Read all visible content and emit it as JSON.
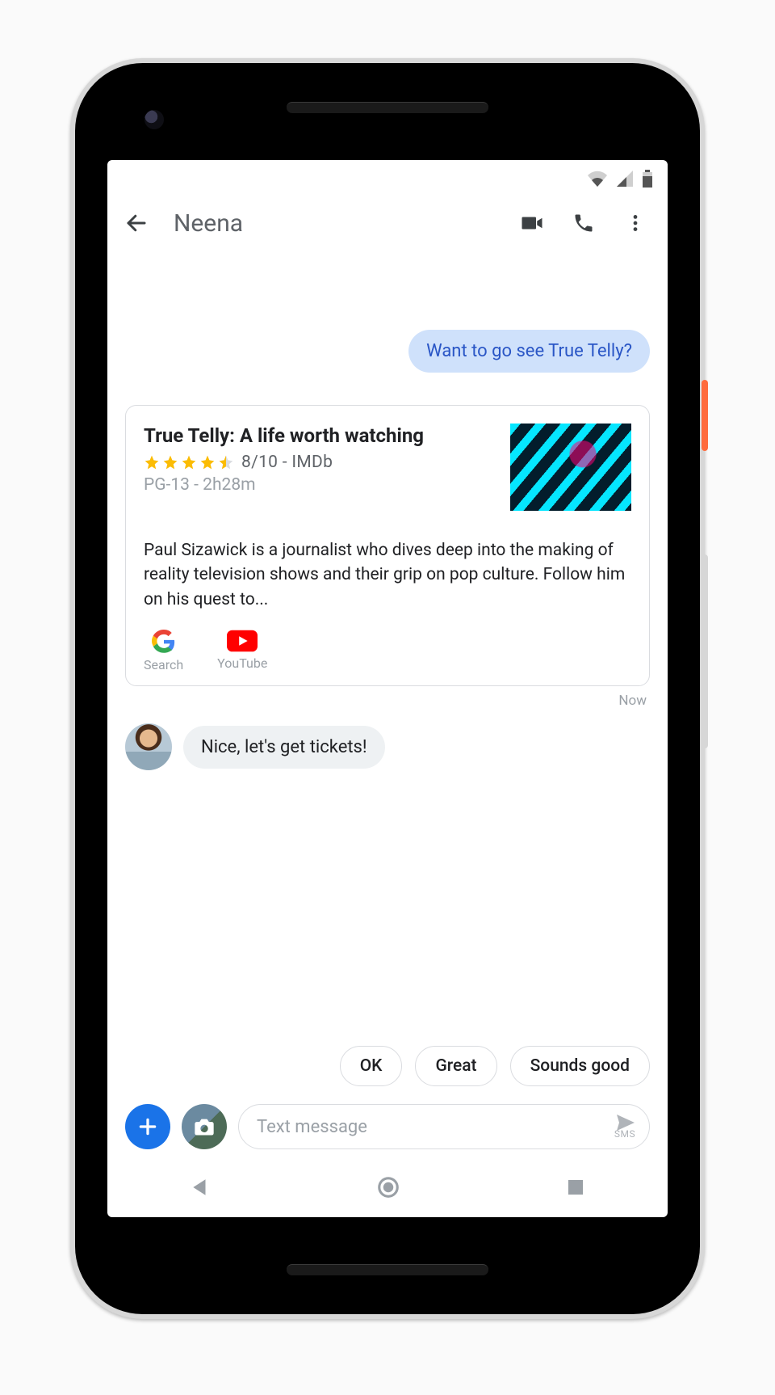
{
  "header": {
    "contact_name": "Neena"
  },
  "messages": {
    "outgoing_1": "Want to go see True Telly?",
    "incoming_1": "Nice, let's get tickets!"
  },
  "card": {
    "title": "True Telly: A life worth watching",
    "rating_text": "8/10 - IMDb",
    "meta": "PG-13 - 2h28m",
    "star_value": 4.5,
    "description": "Paul Sizawick is a journalist who dives deep into the making of reality television shows and their grip on pop culture. Follow him on his quest to...",
    "actions": {
      "search": "Search",
      "youtube": "YouTube"
    },
    "timestamp": "Now"
  },
  "smart_replies": [
    "OK",
    "Great",
    "Sounds good"
  ],
  "composer": {
    "placeholder": "Text message",
    "send_sub": "SMS"
  }
}
